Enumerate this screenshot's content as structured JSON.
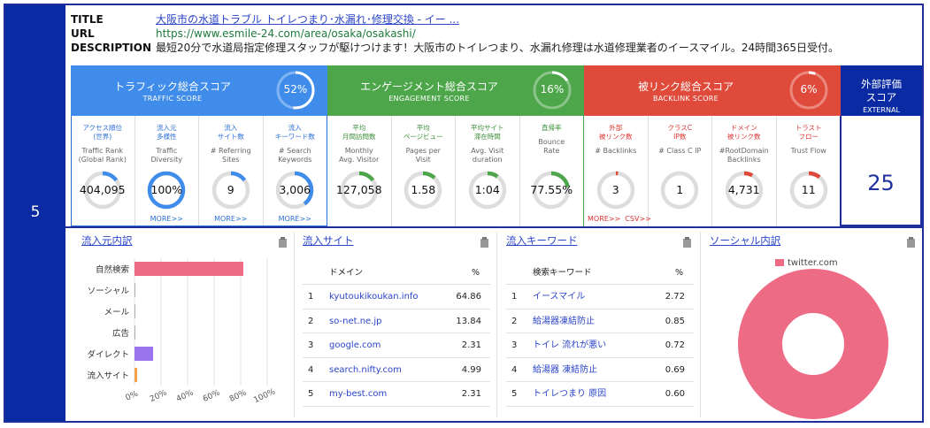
{
  "rank": "5",
  "meta": {
    "title_label": "TITLE",
    "title_value": "大阪市の水道トラブル トイレつまり･水漏れ･修理交換 - イー ...",
    "url_label": "URL",
    "url_value": "https://www.esmile-24.com/area/osaka/osakashi/",
    "desc_label": "DESCRIPTION",
    "desc_value": "最短20分で水道局指定修理スタッフが駆けつけます！大阪市のトイレつまり、水漏れ修理は水道修理業者のイースマイル。24時間365日受付。"
  },
  "colors": {
    "traffic": "#3f8ceb",
    "engagement": "#4ea64a",
    "backlink": "#e04a3a",
    "external": "#0a2aa3",
    "bar_search": "#ee6b86",
    "bar_direct": "#9a73ef",
    "bar_site": "#f4a34a",
    "donut": "#ee6b86"
  },
  "traffic": {
    "title_ja": "トラフィック総合スコア",
    "title_en": "TRAFFIC SCORE",
    "score_text": "52%",
    "score": 52,
    "metrics": [
      {
        "ja": "アクセス順位\n(世界)",
        "en": "Traffic Rank\n(Global Rank)",
        "value": "404,095",
        "fill": 0.15,
        "more": ""
      },
      {
        "ja": "流入元\n多様性",
        "en": "Traffic\nDiversity",
        "value": "100%",
        "fill": 1.0,
        "more": "MORE>>"
      },
      {
        "ja": "流入\nサイト数",
        "en": "# Referring\nSites",
        "value": "9",
        "fill": 0.15,
        "more": "MORE>>"
      },
      {
        "ja": "流入\nキーワード数",
        "en": "# Search\nKeywords",
        "value": "3,006",
        "fill": 0.4,
        "more": "MORE>>"
      }
    ]
  },
  "engagement": {
    "title_ja": "エンゲージメント総合スコア",
    "title_en": "ENGAGEMENT SCORE",
    "score_text": "16%",
    "score": 16,
    "metrics": [
      {
        "ja": "平均\n月間訪問数",
        "en": "Monthly\nAvg. Visitor",
        "value": "127,058",
        "fill": 0.15
      },
      {
        "ja": "平均\nページビュー",
        "en": "Pages per\nVisit",
        "value": "1.58",
        "fill": 0.12
      },
      {
        "ja": "平均サイト\n滞在時間",
        "en": "Avg. Visit\nduration",
        "value": "1:04",
        "fill": 0.1
      },
      {
        "ja": "直帰率",
        "en": "Bounce\nRate",
        "value": "77.55%",
        "fill": 0.22
      }
    ]
  },
  "backlink": {
    "title_ja": "被リンク総合スコア",
    "title_en": "BACKLINK SCORE",
    "score_text": "6%",
    "score": 6,
    "metrics": [
      {
        "ja": "外部\n被リンク数",
        "en": "# Backlinks",
        "value": "3",
        "fill": 0.02
      },
      {
        "ja": "クラスC\nIP数",
        "en": "# Class C IP",
        "value": "1",
        "fill": 0.0
      },
      {
        "ja": "ドメイン\n被リンク数",
        "en": "#RootDomain\nBacklinks",
        "value": "4,731",
        "fill": 0.08
      },
      {
        "ja": "トラスト\nフロー",
        "en": "Trust Flow",
        "value": "11",
        "fill": 0.11
      }
    ],
    "more_text": "MORE>>  CSV>>"
  },
  "external": {
    "title_ja": "外部評価\nスコア",
    "title_en": "EXTERNAL\nSCORE",
    "value": "25"
  },
  "traffic_sources": {
    "title": "流入元内訳",
    "chart_data": {
      "type": "bar",
      "orientation": "horizontal",
      "categories": [
        "自然検索",
        "ソーシャル",
        "メール",
        "広告",
        "ダイレクト",
        "流入サイト"
      ],
      "values": [
        82,
        0,
        0,
        0,
        14,
        2
      ],
      "xlim": [
        0,
        100
      ],
      "xticks": [
        "0%",
        "20%",
        "40%",
        "60%",
        "80%",
        "100%"
      ],
      "grid": true
    }
  },
  "referring_sites": {
    "title": "流入サイト",
    "col_name": "ドメイン",
    "col_pct": "%",
    "rows": [
      {
        "idx": "1",
        "name": "kyutoukikoukan.info",
        "pct": "64.86"
      },
      {
        "idx": "2",
        "name": "so-net.ne.jp",
        "pct": "13.84"
      },
      {
        "idx": "3",
        "name": "google.com",
        "pct": "2.31"
      },
      {
        "idx": "4",
        "name": "search.nifty.com",
        "pct": "4.99"
      },
      {
        "idx": "5",
        "name": "my-best.com",
        "pct": "2.31"
      }
    ]
  },
  "keywords": {
    "title": "流入キーワード",
    "col_name": "検索キーワード",
    "col_pct": "%",
    "rows": [
      {
        "idx": "1",
        "name": "イースマイル",
        "pct": "2.72"
      },
      {
        "idx": "2",
        "name": "給湯器凍結防止",
        "pct": "0.85"
      },
      {
        "idx": "3",
        "name": "トイレ 流れが悪い",
        "pct": "0.72"
      },
      {
        "idx": "4",
        "name": "給湯器 凍結防止",
        "pct": "0.69"
      },
      {
        "idx": "5",
        "name": "トイレつまり 原因",
        "pct": "0.60"
      }
    ]
  },
  "social": {
    "title": "ソーシャル内訳",
    "chart_data": {
      "type": "pie",
      "labels": [
        "twitter.com"
      ],
      "values": [
        100
      ],
      "legend": "top"
    }
  }
}
